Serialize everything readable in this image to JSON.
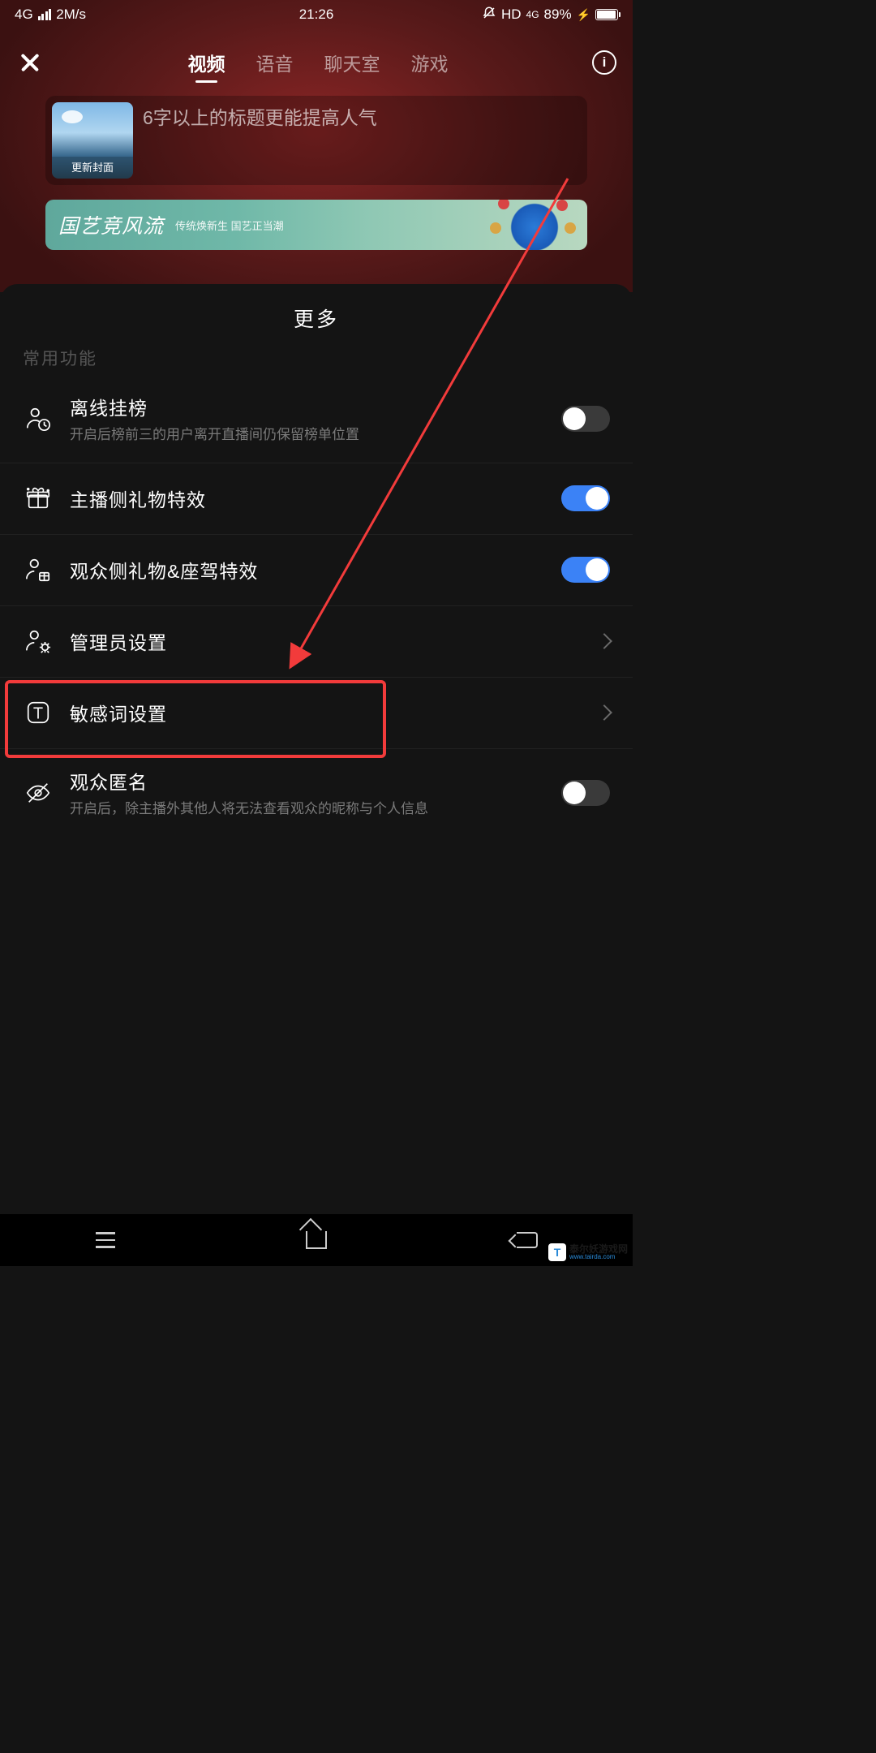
{
  "status": {
    "network": "4G",
    "speed": "2M/s",
    "time": "21:26",
    "hd": "HD",
    "netIcon": "4G",
    "battery_pct": "89%"
  },
  "tabs": [
    "视频",
    "语音",
    "聊天室",
    "游戏"
  ],
  "active_tab_index": 0,
  "title_card": {
    "cover_label": "更新封面",
    "placeholder": "6字以上的标题更能提高人气"
  },
  "banner": {
    "title": "国艺竞风流",
    "subtitle": "传统焕新生 国艺正当潮"
  },
  "panel": {
    "title": "更多",
    "section_label": "常用功能",
    "rows": [
      {
        "icon": "person-clock",
        "title": "离线挂榜",
        "desc": "开启后榜前三的用户离开直播间仍保留榜单位置",
        "type": "switch",
        "on": false
      },
      {
        "icon": "gift",
        "title": "主播侧礼物特效",
        "desc": "",
        "type": "switch",
        "on": true
      },
      {
        "icon": "person-gift",
        "title": "观众侧礼物&座驾特效",
        "desc": "",
        "type": "switch",
        "on": true
      },
      {
        "icon": "person-gear",
        "title": "管理员设置",
        "desc": "",
        "type": "chevron"
      },
      {
        "icon": "text-box",
        "title": "敏感词设置",
        "desc": "",
        "type": "chevron"
      },
      {
        "icon": "eye-off",
        "title": "观众匿名",
        "desc": "开启后，除主播外其他人将无法查看观众的昵称与个人信息",
        "type": "switch",
        "on": false
      }
    ]
  },
  "watermark": {
    "badge": "T",
    "brand": "泰尔妖游戏网",
    "url": "www.tairda.com"
  }
}
